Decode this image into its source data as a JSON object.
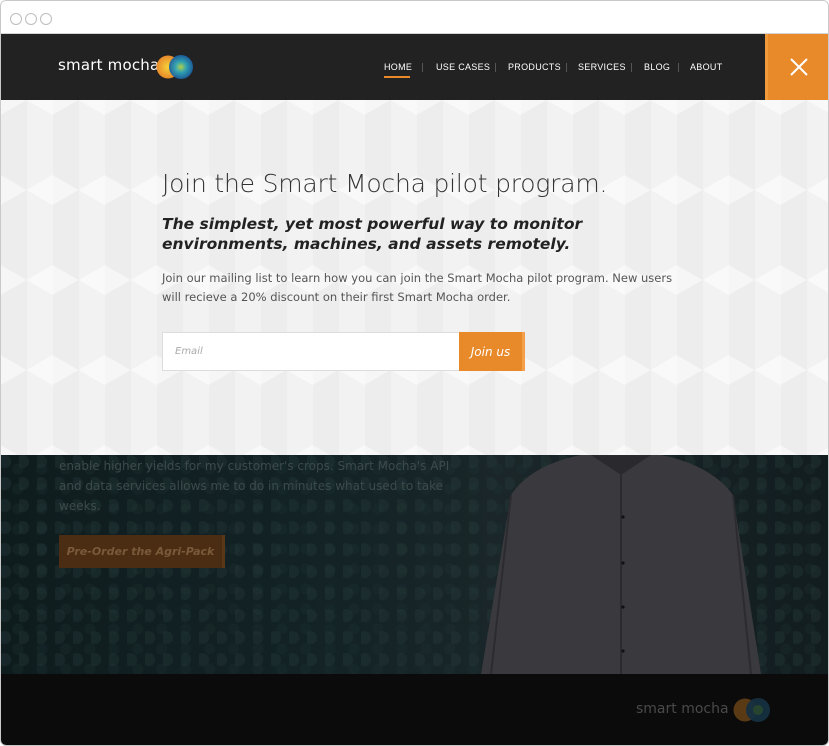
{
  "header": {
    "brand": "smart mocha",
    "nav": [
      {
        "label": "HOME"
      },
      {
        "label": "USE CASES"
      },
      {
        "label": "PRODUCTS"
      },
      {
        "label": "SERVICES"
      },
      {
        "label": "BLOG"
      },
      {
        "label": "ABOUT"
      }
    ],
    "active_nav": "HOME",
    "close_icon": "close-icon"
  },
  "signup": {
    "title": "Join the Smart Mocha pilot program.",
    "subtitle": "The simplest, yet most powerful way to monitor environments, machines, and assets remotely.",
    "body": "Join our mailing list to learn how you can join the Smart Mocha pilot program. New users will recieve a 20% discount on their first Smart Mocha order.",
    "email_placeholder": "Email",
    "email_value": "",
    "join_label": "Join us"
  },
  "hero": {
    "quote": "enable higher yields for my customer's crops. Smart Mocha's API and data services allows me to do in minutes what used to take weeks.",
    "cta_label": "Pre-Order the Agri-Pack"
  },
  "footer": {
    "brand": "smart mocha"
  },
  "colors": {
    "accent": "#e8892a",
    "header_bg": "#222222",
    "overlay_bg": "#f2f2f2",
    "footer_bg": "#0b0b0b"
  }
}
